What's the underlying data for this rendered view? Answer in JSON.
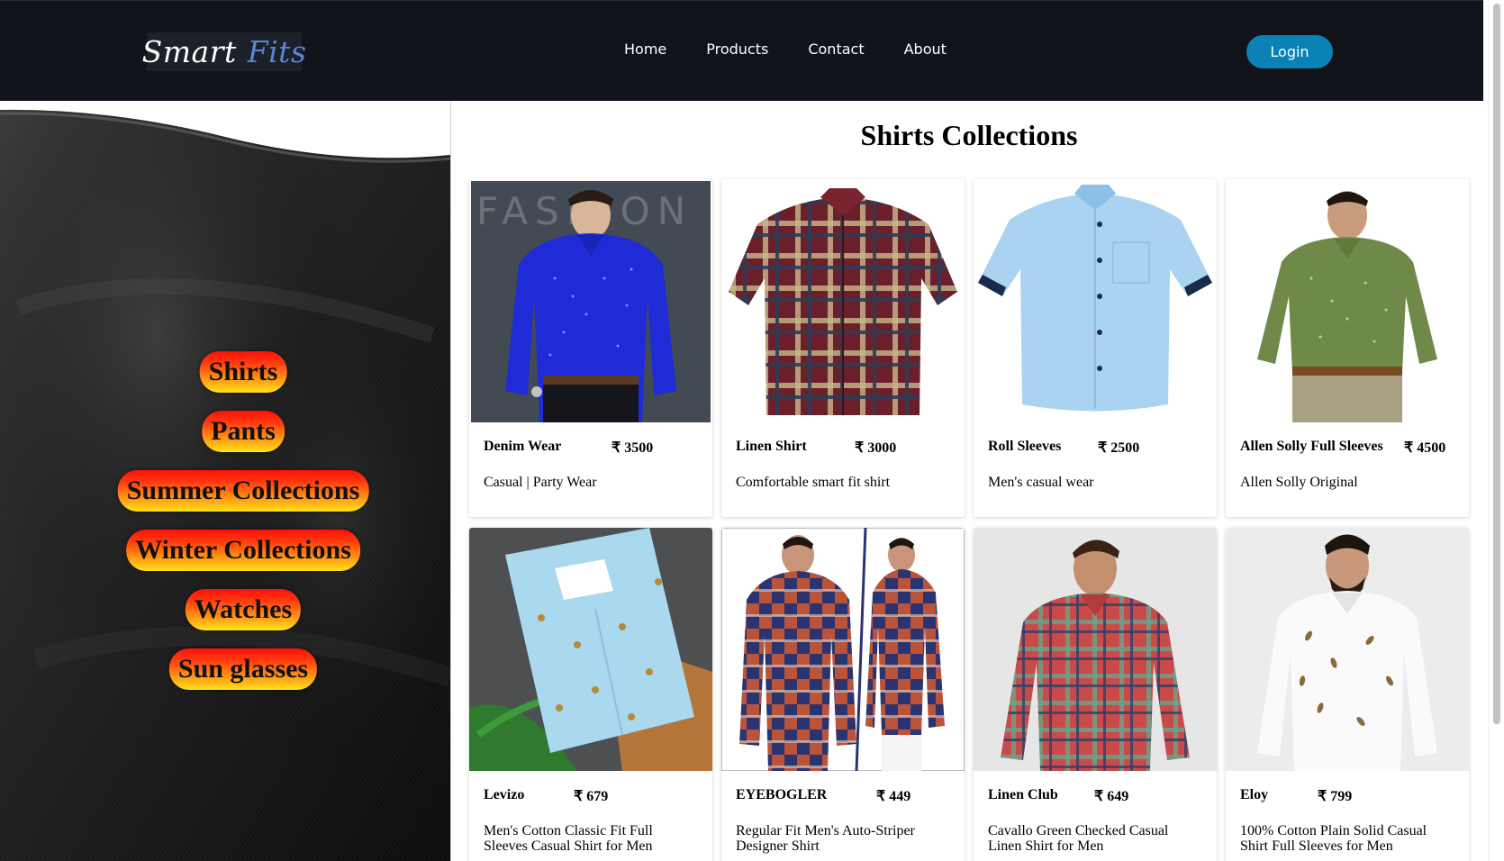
{
  "brand": {
    "part1": "Smart",
    "part2": "Fits"
  },
  "nav": {
    "links": [
      "Home",
      "Products",
      "Contact",
      "About"
    ],
    "login_label": "Login"
  },
  "sidebar": {
    "categories": [
      "Shirts",
      "Pants",
      "Summer Collections",
      "Winter Collections",
      "Watches",
      "Sun glasses"
    ]
  },
  "main": {
    "title": "Shirts Collections",
    "currency": "₹",
    "products": [
      {
        "name": "Denim Wear",
        "price": "3500",
        "desc": "Casual | Party Wear"
      },
      {
        "name": "Linen Shirt",
        "price": "3000",
        "desc": "Comfortable smart fit shirt"
      },
      {
        "name": "Roll Sleeves",
        "price": "2500",
        "desc": "Men's casual wear"
      },
      {
        "name": "Allen Solly Full Sleeves",
        "price": "4500",
        "desc": "Allen Solly Original"
      },
      {
        "name": "Levizo",
        "price": "679",
        "desc": "Men's Cotton Classic Fit Full Sleeves Casual Shirt for Men"
      },
      {
        "name": "EYEBOGLER",
        "price": "449",
        "desc": "Regular Fit Men's Auto-Striper Designer Shirt"
      },
      {
        "name": "Linen Club",
        "price": "649",
        "desc": "Cavallo Green Checked Casual Linen Shirt for Men"
      },
      {
        "name": "Eloy",
        "price": "799",
        "desc": "100% Cotton Plain Solid Casual Shirt Full Sleeves for Men"
      }
    ]
  }
}
